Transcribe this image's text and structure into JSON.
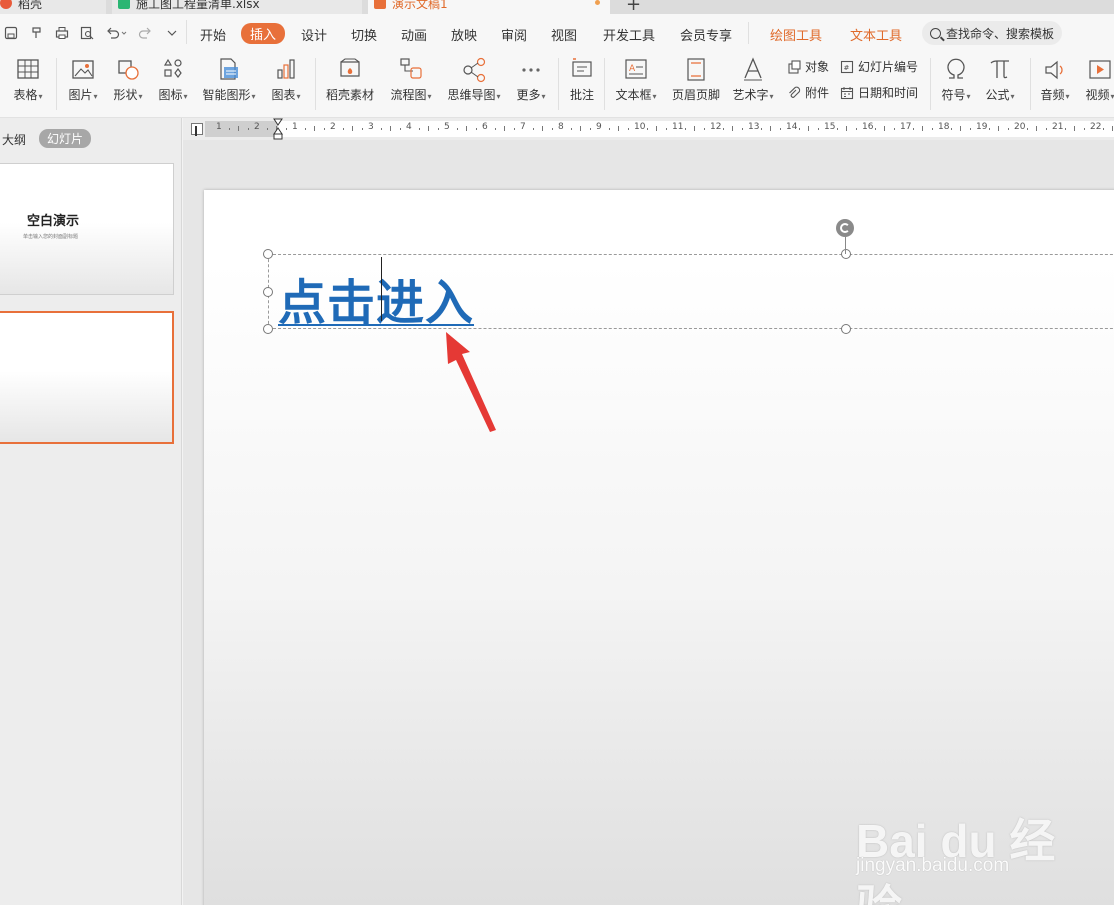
{
  "tabs": [
    {
      "label": "稻壳",
      "color": "#e85a3a"
    },
    {
      "label": "施工图工程量清单.xlsx",
      "color": "#2bb673"
    },
    {
      "label": "演示文稿1",
      "color": "#e8703a"
    }
  ],
  "new_tab_label": "+",
  "menu": {
    "items": [
      "开始",
      "插入",
      "设计",
      "切换",
      "动画",
      "放映",
      "审阅",
      "视图",
      "开发工具",
      "会员专享"
    ],
    "active": "插入",
    "context_tabs": [
      "绘图工具",
      "文本工具"
    ],
    "search_placeholder": "查找命令、搜索模板"
  },
  "ribbon": {
    "table": "表格",
    "picture": "图片",
    "shape": "形状",
    "icon": "图标",
    "smartart": "智能图形",
    "chart": "图表",
    "docer_material": "稻壳素材",
    "flowchart": "流程图",
    "mindmap": "思维导图",
    "more": "更多",
    "comment": "批注",
    "textbox": "文本框",
    "header_footer": "页眉页脚",
    "wordart": "艺术字",
    "object": "对象",
    "attachment": "附件",
    "slide_number": "幻灯片编号",
    "datetime": "日期和时间",
    "symbol": "符号",
    "formula": "公式",
    "audio": "音频",
    "video": "视频"
  },
  "left_pane": {
    "outline_tab": "大纲",
    "slides_tab": "幻灯片",
    "thumb1_title": "空白演示",
    "thumb1_subtitle": "单击输入您的封面副标题"
  },
  "ruler": {
    "numbers": [
      "1",
      "2",
      "1",
      "2",
      "3",
      "4",
      "5",
      "6",
      "7",
      "8",
      "9",
      "10",
      "11",
      "12",
      "13",
      "14",
      "15",
      "16",
      "17",
      "18",
      "19",
      "20",
      "21",
      "22"
    ]
  },
  "slide": {
    "text": "点击进入"
  },
  "watermark": {
    "logo": "Bai du 经验",
    "url": "jingyan.baidu.com"
  },
  "colors": {
    "accent": "#e8703a",
    "text_blue": "#1f6ab7",
    "arrow_red": "#e53935"
  }
}
